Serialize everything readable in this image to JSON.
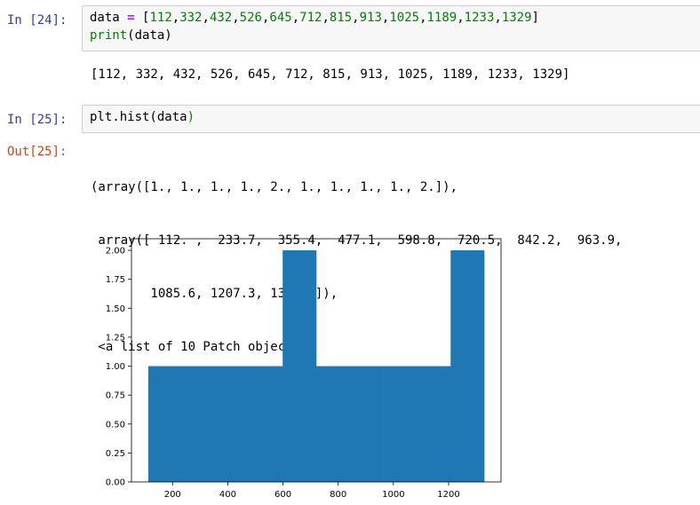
{
  "cells": [
    {
      "prompt": "In [24]:",
      "code": {
        "line1": {
          "name": "data",
          "op": "=",
          "open": "[",
          "values": [
            "112",
            "332",
            "432",
            "526",
            "645",
            "712",
            "815",
            "913",
            "1025",
            "1189",
            "1233",
            "1329"
          ],
          "close": "]"
        },
        "line2": {
          "func": "print",
          "arg": "(data)"
        }
      },
      "output": "[112, 332, 432, 526, 645, 712, 815, 913, 1025, 1189, 1233, 1329]"
    },
    {
      "prompt": "In [25]:",
      "code": "plt.hist(data)",
      "out_prompt": "Out[25]:",
      "output_lines": [
        "(array([1., 1., 1., 1., 2., 1., 1., 1., 1., 2.]),",
        " array([ 112. ,  233.7,  355.4,  477.1,  598.8,  720.5,  842.2,  963.9,",
        "        1085.6, 1207.3, 1329. ]),",
        " <a list of 10 Patch objects>)"
      ]
    }
  ],
  "chart_data": {
    "type": "bar",
    "bin_edges": [
      112.0,
      233.7,
      355.4,
      477.1,
      598.8,
      720.5,
      842.2,
      963.9,
      1085.6,
      1207.3,
      1329.0
    ],
    "values": [
      1,
      1,
      1,
      1,
      2,
      1,
      1,
      1,
      1,
      2
    ],
    "color": "#1f77b4",
    "xlim": [
      51.15,
      1389.85
    ],
    "ylim": [
      0,
      2.1
    ],
    "xticks": [
      "200",
      "400",
      "600",
      "800",
      "1000",
      "1200"
    ],
    "yticks": [
      "0.00",
      "0.25",
      "0.50",
      "0.75",
      "1.00",
      "1.25",
      "1.50",
      "1.75",
      "2.00"
    ],
    "title": "",
    "xlabel": "",
    "ylabel": "",
    "grid": false
  }
}
